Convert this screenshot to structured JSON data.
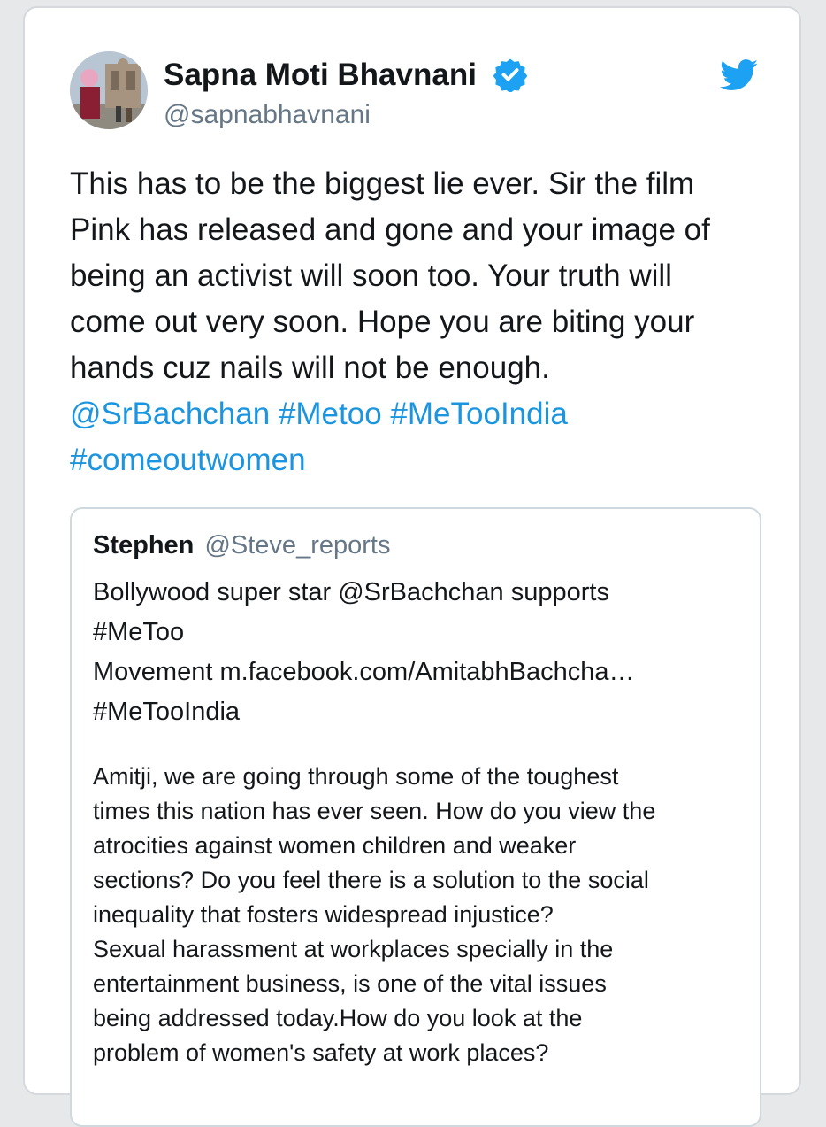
{
  "tweet": {
    "author_name": "Sapna Moti Bhavnani",
    "author_handle": "@sapnabhavnani",
    "verified_icon": "verified-badge-icon",
    "logo_icon": "twitter-bird-icon",
    "text_lines": [
      "This has to be the biggest lie ever. Sir the film",
      "Pink has released and gone and your image of",
      "being an activist will soon too. Your truth will",
      "come out very soon. Hope you are biting your",
      "hands cuz nails will not be enough."
    ],
    "mention": "@SrBachchan",
    "hashtag_1": "#Metoo",
    "hashtag_2": "#MeTooIndia",
    "hashtag_3": "#comeoutwomen"
  },
  "quoted_tweet": {
    "author_name": "Stephen",
    "author_handle": "@Steve_reports",
    "text_lines": [
      "Bollywood super star @SrBachchan supports",
      "#MeToo",
      "Movement m.facebook.com/AmitabhBachcha…",
      "#MeTooIndia"
    ],
    "article_lines": [
      "Amitji, we are going through some of the toughest",
      "times this nation has ever seen. How do you view the",
      "atrocities against women children and weaker",
      "sections? Do you feel there is a solution to the social",
      "inequality that fosters widespread injustice?",
      "Sexual harassment at workplaces specially in the",
      "entertainment business, is one of the vital issues",
      "being addressed today.How do you look at the",
      "problem of women's safety at work places?"
    ]
  },
  "colors": {
    "link": "#1b95e0",
    "text": "#14171a",
    "secondary": "#657786",
    "verified": "#1da1f2"
  }
}
